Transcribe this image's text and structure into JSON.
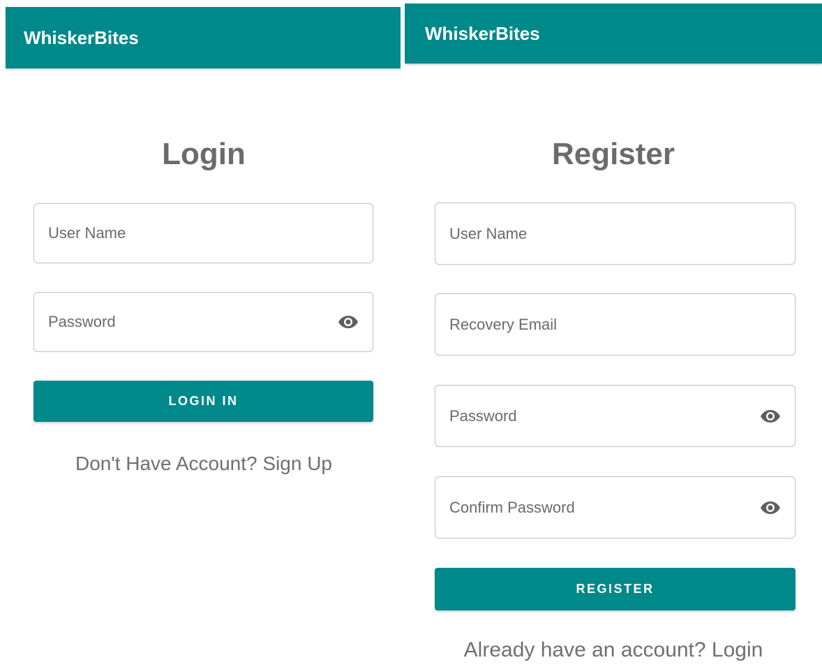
{
  "login_screen": {
    "app_title": "WhiskerBites",
    "page_title": "Login",
    "fields": {
      "username_placeholder": "User Name",
      "password_placeholder": "Password"
    },
    "button_label": "LOGIN IN",
    "switch_text": "Don't Have Account? Sign Up"
  },
  "register_screen": {
    "app_title": "WhiskerBites",
    "page_title": "Register",
    "fields": {
      "username_placeholder": "User Name",
      "email_placeholder": "Recovery Email",
      "password_placeholder": "Password",
      "confirm_placeholder": "Confirm Password"
    },
    "button_label": "REGISTER",
    "switch_text": "Already have an account? Login"
  },
  "icons": {
    "visibility_toggle": "eye-icon"
  },
  "colors": {
    "primary": "#00898a",
    "title_text": "#6b6b6b",
    "field_border": "#bfbfbf",
    "link_text": "#6f6f6f"
  }
}
